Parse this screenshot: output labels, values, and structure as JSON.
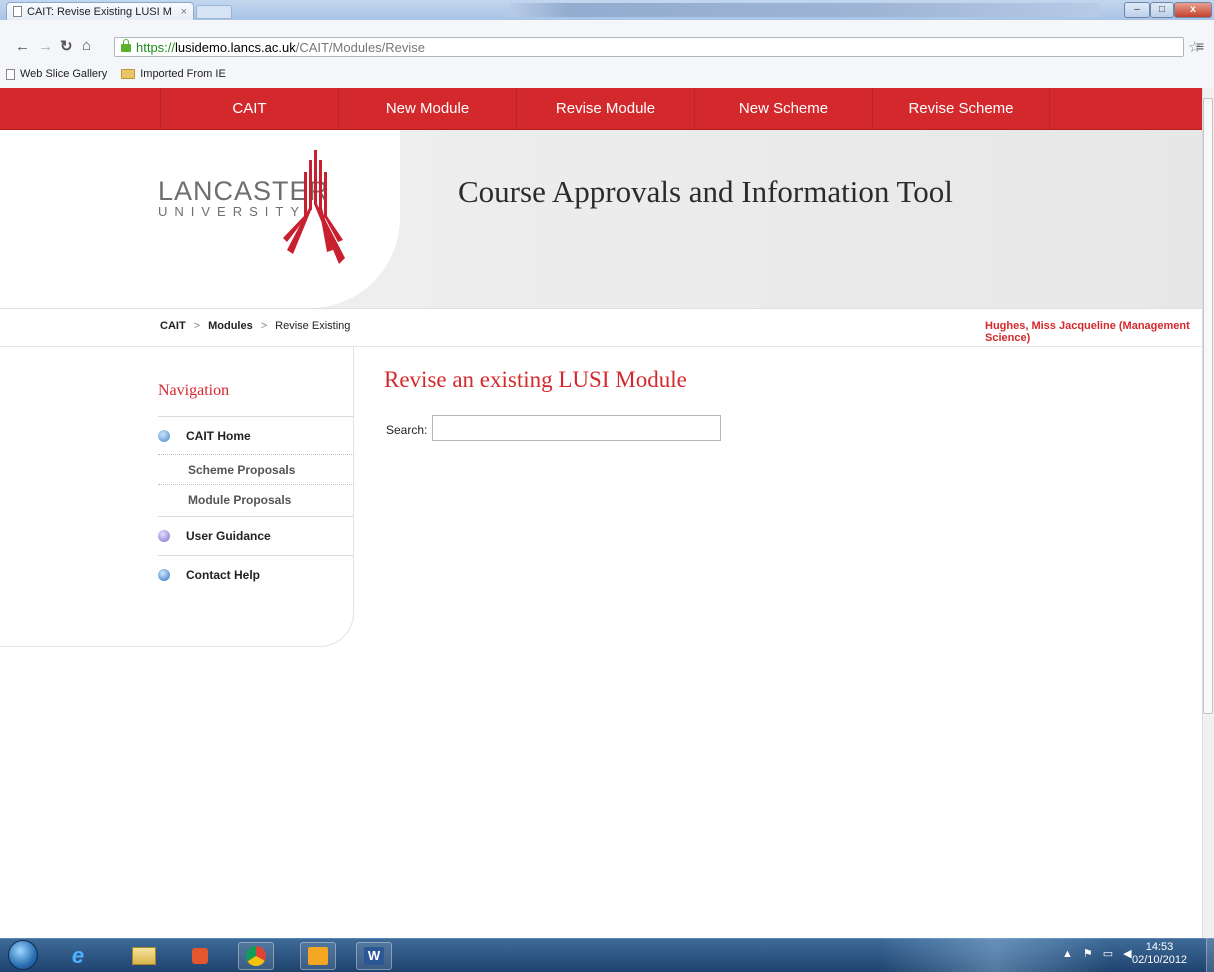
{
  "browser": {
    "tab_title": "CAIT: Revise Existing LUSI M",
    "tab_close": "×",
    "url_scheme": "https://",
    "url_host": "lusidemo.lancs.ac.uk",
    "url_path": "/CAIT/Modules/Revise",
    "bookmarks": [
      "Web Slice Gallery",
      "Imported From IE"
    ]
  },
  "topnav": {
    "items": [
      "CAIT",
      "New Module",
      "Revise Module",
      "New Scheme",
      "Revise Scheme"
    ]
  },
  "banner": {
    "logo_line1": "LANCASTER",
    "logo_line2": "UNIVERSITY",
    "site_title": "Course Approvals and Information Tool",
    "brand_color": "#d4292c"
  },
  "breadcrumb": {
    "items": [
      "CAIT",
      "Modules",
      "Revise Existing"
    ],
    "separator": ">"
  },
  "user": {
    "name": "Hughes, Miss Jacqueline (Management Science)"
  },
  "navigation": {
    "heading": "Navigation",
    "home": {
      "label": "CAIT Home",
      "icon": "home-icon"
    },
    "sub_items": [
      "Scheme Proposals",
      "Module Proposals"
    ],
    "guidance": {
      "label": "User Guidance",
      "icon": "info-icon"
    },
    "help": {
      "label": "Contact Help",
      "icon": "help-icon"
    }
  },
  "main": {
    "heading": "Revise an existing LUSI Module",
    "search_label": "Search:",
    "search_value": ""
  },
  "taskbar": {
    "apps": [
      "internet-explorer-icon",
      "file-explorer-icon",
      "media-player-icon",
      "chrome-icon",
      "outlook-icon",
      "word-icon"
    ],
    "time": "14:53",
    "date": "02/10/2012"
  }
}
